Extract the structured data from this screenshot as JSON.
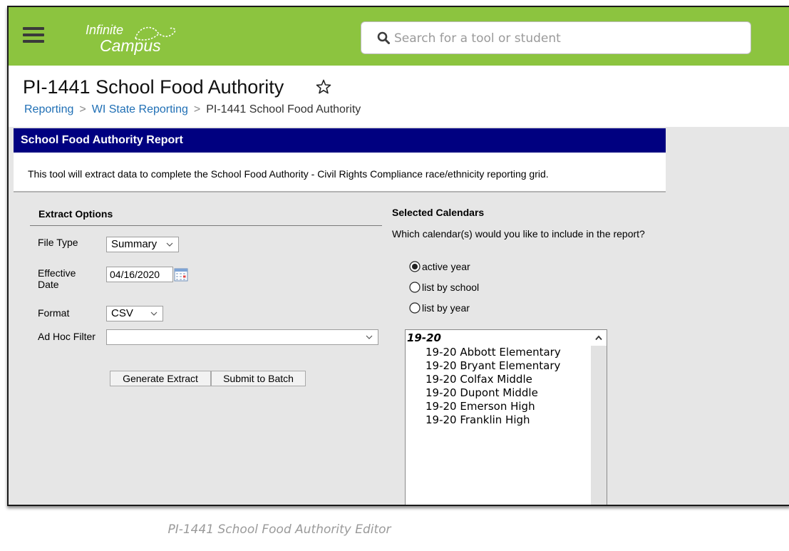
{
  "app": {
    "logo_line1": "Infinite",
    "logo_line2": "Campus",
    "search_placeholder": "Search for a tool or student"
  },
  "page": {
    "title": "PI-1441 School Food Authority",
    "breadcrumb": [
      "Reporting",
      "WI State Reporting",
      "PI-1441 School Food Authority"
    ]
  },
  "panel": {
    "header": "School Food Authority Report",
    "description": "This tool will extract data to complete the School Food Authority - Civil Rights Compliance race/ethnicity reporting grid."
  },
  "extract_options": {
    "title": "Extract Options",
    "file_type_label": "File Type",
    "file_type_value": "Summary",
    "effective_date_label": "Effective Date",
    "effective_date_value": "04/16/2020",
    "format_label": "Format",
    "format_value": "CSV",
    "ad_hoc_filter_label": "Ad Hoc Filter",
    "ad_hoc_filter_value": "",
    "generate_button": "Generate Extract",
    "batch_button": "Submit to Batch"
  },
  "calendars": {
    "title": "Selected Calendars",
    "question": "Which calendar(s) would you like to include in the report?",
    "options": [
      {
        "label": "active year",
        "selected": true
      },
      {
        "label": "list by school",
        "selected": false
      },
      {
        "label": "list by year",
        "selected": false
      }
    ],
    "group": "19-20",
    "items": [
      "19-20 Abbott Elementary",
      "19-20 Bryant Elementary",
      "19-20 Colfax Middle",
      "19-20 Dupont Middle",
      "19-20 Emerson High",
      "19-20 Franklin High"
    ]
  },
  "caption": "PI-1441 School Food Authority Editor",
  "colors": {
    "topbar": "#8cc43f",
    "panel_header": "#000080",
    "link": "#1f6fb5",
    "background": "#e6e6e6"
  },
  "icons": [
    "hamburger-menu-icon",
    "search-icon",
    "star-outline-icon",
    "calendar-icon",
    "chevron-down-icon",
    "radio-icon",
    "scroll-up-arrow-icon"
  ]
}
